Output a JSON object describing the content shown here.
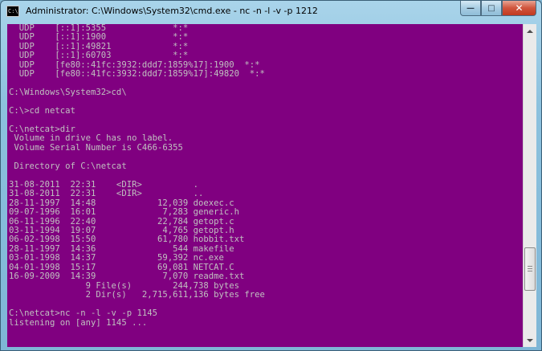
{
  "window": {
    "title": "Administrator: C:\\Windows\\System32\\cmd.exe - nc  -n -l -v -p 1212",
    "icon": "cmd-icon",
    "buttons": {
      "minimize": "—",
      "maximize": "□",
      "close": "✕"
    }
  },
  "console": {
    "background": "#800080",
    "foreground": "#c0c0c0",
    "lines": [
      "  UDP    [::1]:5355             *:*",
      "  UDP    [::1]:1900             *:*",
      "  UDP    [::1]:49821            *:*",
      "  UDP    [::1]:60703            *:*",
      "  UDP    [fe80::41fc:3932:ddd7:1859%17]:1900  *:*",
      "  UDP    [fe80::41fc:3932:ddd7:1859%17]:49820  *:*",
      "",
      "C:\\Windows\\System32>cd\\",
      "",
      "C:\\>cd netcat",
      "",
      "C:\\netcat>dir",
      " Volume in drive C has no label.",
      " Volume Serial Number is C466-6355",
      "",
      " Directory of C:\\netcat",
      "",
      "31-08-2011  22:31    <DIR>          .",
      "31-08-2011  22:31    <DIR>          ..",
      "28-11-1997  14:48            12,039 doexec.c",
      "09-07-1996  16:01             7,283 generic.h",
      "06-11-1996  22:40            22,784 getopt.c",
      "03-11-1994  19:07             4,765 getopt.h",
      "06-02-1998  15:50            61,780 hobbit.txt",
      "28-11-1997  14:36               544 makefile",
      "03-01-1998  14:37            59,392 nc.exe",
      "04-01-1998  15:17            69,081 NETCAT.C",
      "16-09-2009  14:39             7,070 readme.txt",
      "               9 File(s)        244,738 bytes",
      "               2 Dir(s)   2,715,611,136 bytes free",
      "",
      "C:\\netcat>nc -n -l -v -p 1145",
      "listening on [any] 1145 ..."
    ]
  }
}
